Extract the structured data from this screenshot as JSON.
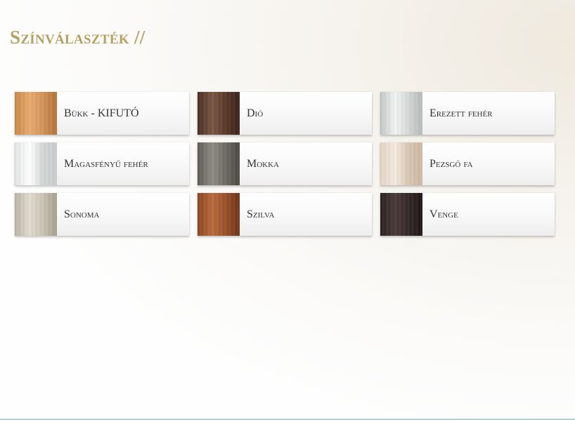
{
  "page": {
    "title": "Színválaszték //"
  },
  "swatches": [
    {
      "label": "Bükk - KIFUTÓ",
      "texture": "beech-texture",
      "colors": [
        "#c9874a",
        "#e7ab6e",
        "#d3945a",
        "#b27138"
      ]
    },
    {
      "label": "Dió",
      "texture": "walnut-texture",
      "colors": [
        "#4a2e22",
        "#7a5645",
        "#5b3a2b",
        "#3a2219"
      ]
    },
    {
      "label": "Erezett fehér",
      "texture": "grained-white-texture",
      "colors": [
        "#c2c5c5",
        "#f2f3f3",
        "#d6d8d8",
        "#b6b9b9"
      ]
    },
    {
      "label": "Magasfényű fehér",
      "texture": "high-gloss-white-texture",
      "colors": [
        "#e2e4e4",
        "#ffffff",
        "#d5d7d7",
        "#c8cbcb"
      ]
    },
    {
      "label": "Mokka",
      "texture": "mocha-texture",
      "colors": [
        "#5d5a55",
        "#8e8a84",
        "#6f6b65",
        "#4a4742"
      ]
    },
    {
      "label": "Pezsgő fa",
      "texture": "champagne-wood-texture",
      "colors": [
        "#e2d3c4",
        "#f4eadf",
        "#d9c6b3",
        "#cdb7a2"
      ]
    },
    {
      "label": "Sonoma",
      "texture": "sonoma-oak-texture",
      "colors": [
        "#b9b2a3",
        "#e0dbcf",
        "#cbc4b5",
        "#a59d8d"
      ]
    },
    {
      "label": "Szilva",
      "texture": "plum-wood-texture",
      "colors": [
        "#8a4420",
        "#b86a3e",
        "#9b522b",
        "#6e3318"
      ]
    },
    {
      "label": "Venge",
      "texture": "wenge-texture",
      "colors": [
        "#2a2020",
        "#4a3a38",
        "#352928",
        "#1e1616"
      ]
    }
  ]
}
